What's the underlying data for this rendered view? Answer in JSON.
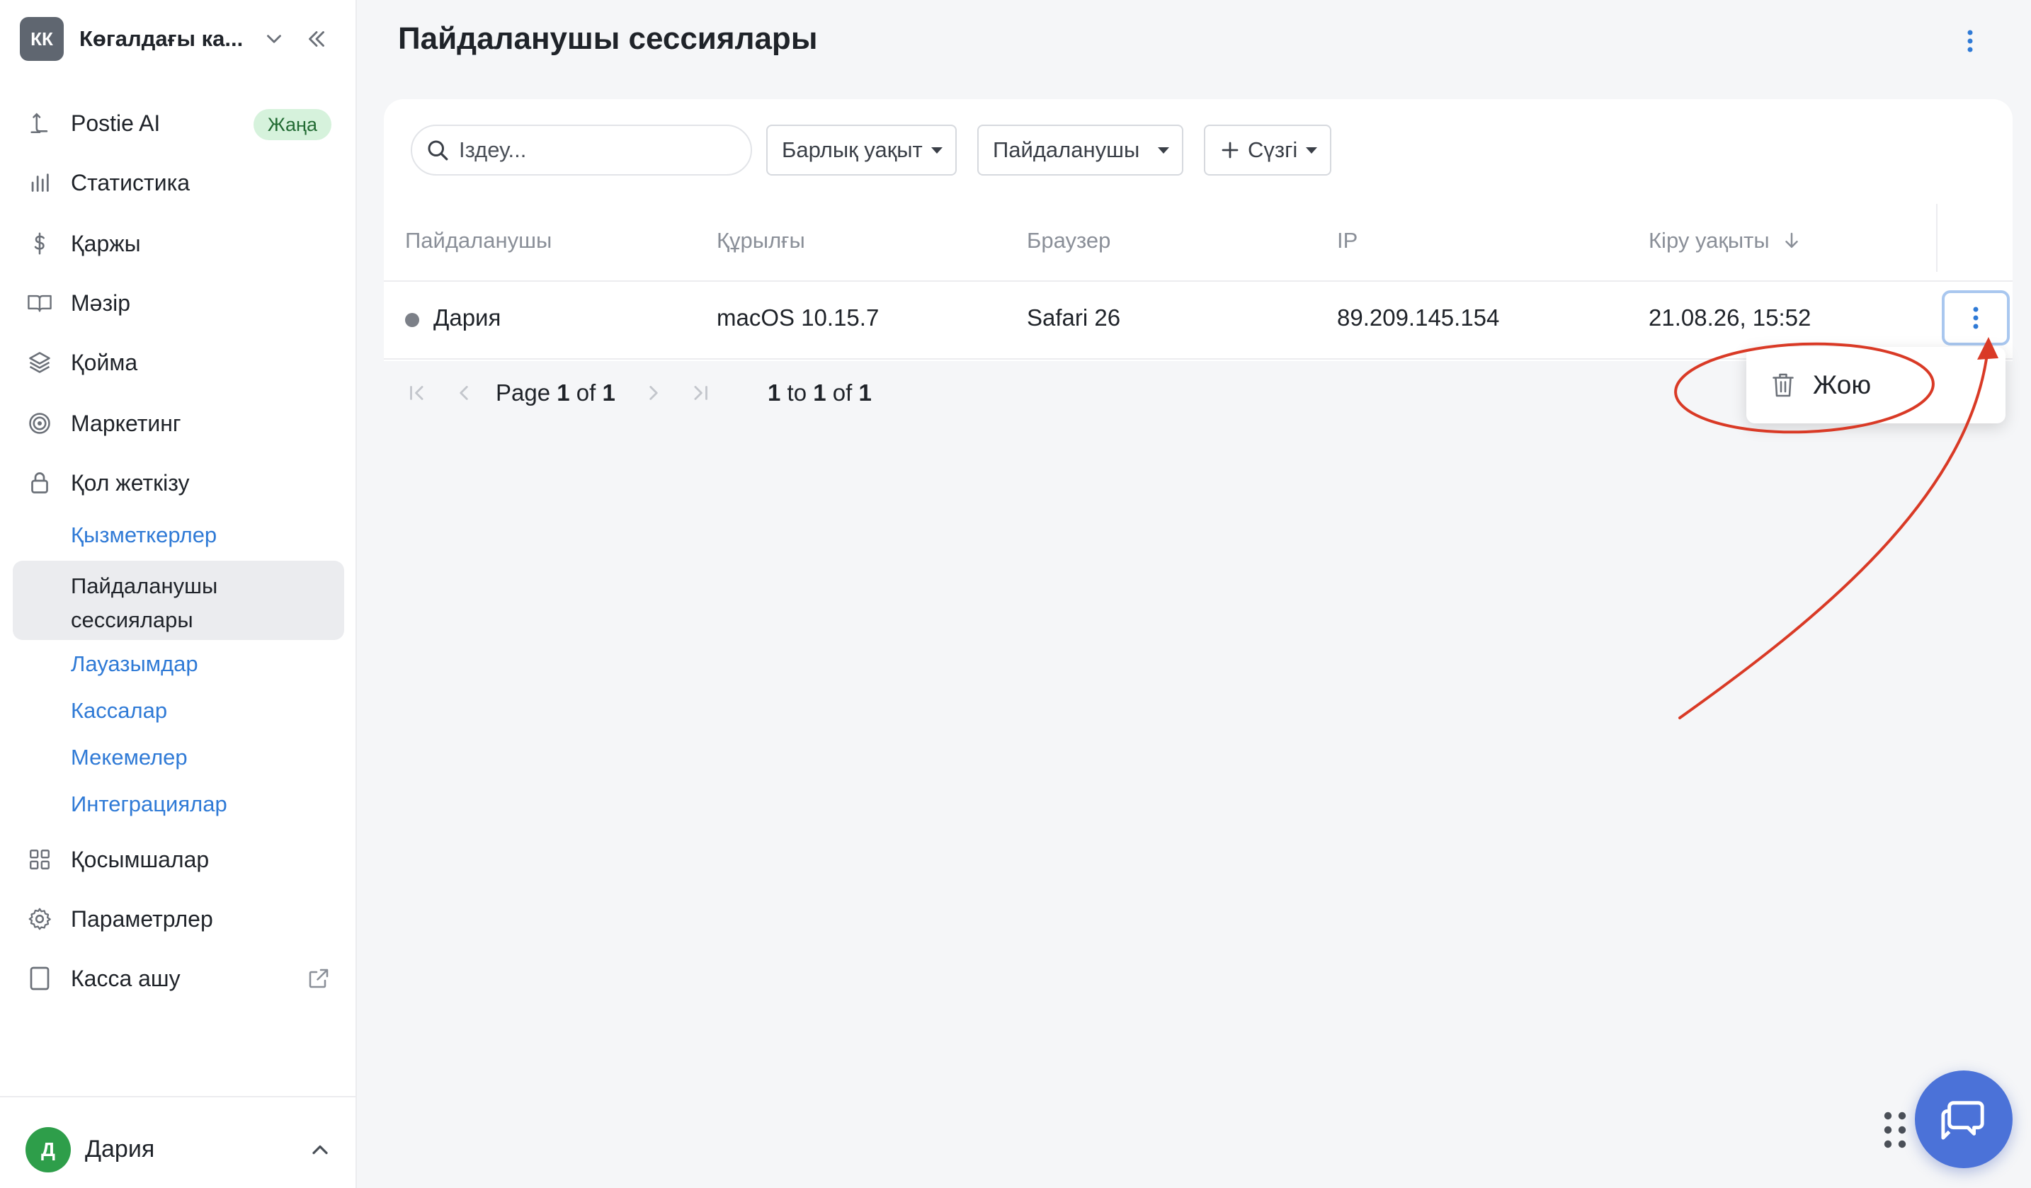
{
  "org": {
    "initials": "КК",
    "name": "Көгалдағы ка..."
  },
  "nav": {
    "postie": {
      "label": "Postie AI",
      "badge": "Жаңа"
    },
    "stats": "Статистика",
    "finance": "Қаржы",
    "menu": "Мәзір",
    "warehouse": "Қойма",
    "marketing": "Маркетинг",
    "access": "Қол жеткізу",
    "access_sub": {
      "employees": "Қызметкерлер",
      "sessions": "Пайдаланушы сессиялары",
      "positions": "Лауазымдар",
      "cashboxes": "Кассалар",
      "venues": "Мекемелер",
      "integrations": "Интеграциялар"
    },
    "apps": "Қосымшалар",
    "settings": "Параметрлер",
    "open_cashbox": "Касса ашу"
  },
  "user": {
    "initial": "Д",
    "name": "Дария"
  },
  "page": {
    "title": "Пайдаланушы сессиялары"
  },
  "toolbar": {
    "search_placeholder": "Іздеу...",
    "filter_time": "Барлық уақыт",
    "filter_user": "Пайдаланушы",
    "filter_add": "Сүзгі"
  },
  "table": {
    "headers": {
      "user": "Пайдаланушы",
      "device": "Құрылғы",
      "browser": "Браузер",
      "ip": "IP",
      "login_time": "Кіру уақыты"
    },
    "rows": [
      {
        "user": "Дария",
        "device": "macOS 10.15.7",
        "browser": "Safari 26",
        "ip": "89.209.145.154",
        "login_time": "21.08.26, 15:52"
      }
    ]
  },
  "pager": {
    "page_word": "Page",
    "page": "1",
    "of_word": "of",
    "total_pages": "1",
    "range_start": "1",
    "to_word": "to",
    "range_end": "1",
    "of_word2": "of",
    "total_rows": "1"
  },
  "row_menu": {
    "delete": "Жою"
  },
  "colors": {
    "accent": "#2f7ad6",
    "annotation": "#d93a26",
    "chat": "#4b72d8"
  }
}
